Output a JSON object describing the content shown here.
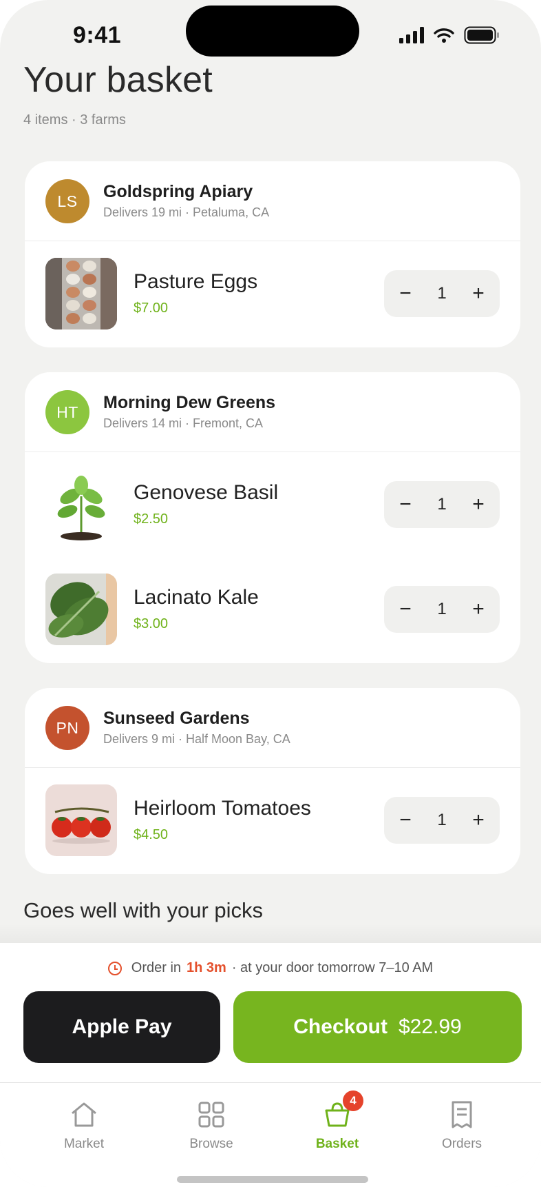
{
  "status_bar": {
    "time": "9:41"
  },
  "header": {
    "title": "Your basket",
    "subtitle": "4 items · 3 farms"
  },
  "farms": [
    {
      "initials": "LS",
      "name": "Goldspring Apiary",
      "meta": "Delivers 19 mi · Petaluma, CA",
      "color": "#be8a2e",
      "items": [
        {
          "name": "Pasture Eggs",
          "price": "$7.00",
          "qty": "1",
          "image": "eggs-photo"
        }
      ]
    },
    {
      "initials": "HT",
      "name": "Morning Dew Greens",
      "meta": "Delivers 14 mi · Fremont, CA",
      "color": "#8cc63f",
      "items": [
        {
          "name": "Genovese Basil",
          "price": "$2.50",
          "qty": "1",
          "image": "basil-photo"
        },
        {
          "name": "Lacinato Kale",
          "price": "$3.00",
          "qty": "1",
          "image": "kale-photo"
        }
      ]
    },
    {
      "initials": "PN",
      "name": "Sunseed Gardens",
      "meta": "Delivers 9 mi · Half Moon Bay, CA",
      "color": "#c4522e",
      "items": [
        {
          "name": "Heirloom Tomatoes",
          "price": "$4.50",
          "qty": "1",
          "image": "tomatoes-photo"
        }
      ]
    }
  ],
  "stepper": {
    "minus": "−",
    "plus": "+"
  },
  "suggestions": {
    "title": "Goes well with your picks"
  },
  "delivery": {
    "prefix": "Order in",
    "time_left": "1h 3m",
    "suffix": "· at your door tomorrow 7–10 AM"
  },
  "actions": {
    "apple_pay": "Apple Pay",
    "checkout": "Checkout",
    "total": "$22.99"
  },
  "tabs": [
    {
      "label": "Market",
      "icon": "home-icon"
    },
    {
      "label": "Browse",
      "icon": "grid-icon"
    },
    {
      "label": "Basket",
      "icon": "basket-icon",
      "badge": "4"
    },
    {
      "label": "Orders",
      "icon": "receipt-icon"
    }
  ],
  "colors": {
    "accent": "#77b51f",
    "price": "#6fb21a",
    "urgent": "#e4502c",
    "badge": "#e5432b"
  }
}
